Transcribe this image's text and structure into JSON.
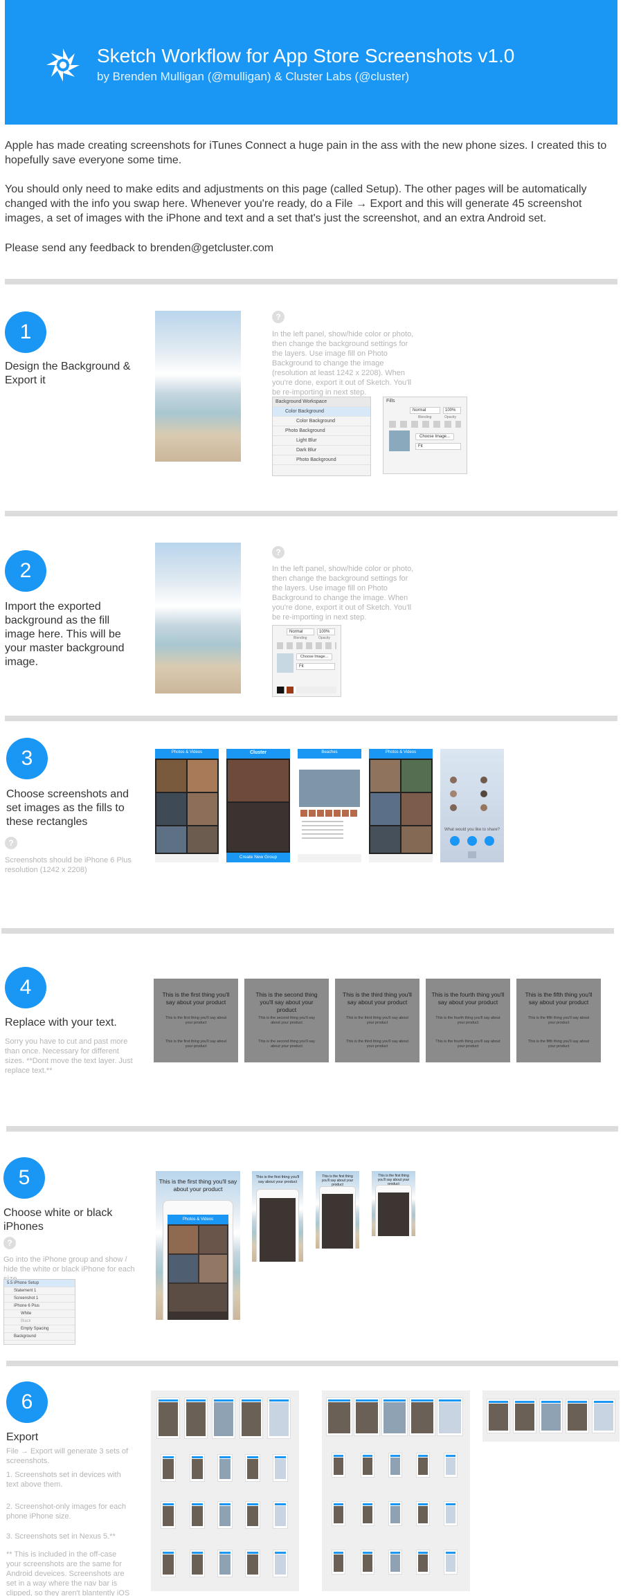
{
  "header": {
    "title": "Sketch Workflow for App Store Screenshots v1.0",
    "subtitle": "by Brenden Mulligan (@mulligan) & Cluster Labs (@cluster)",
    "bg_color": "#1a96f4"
  },
  "intro": {
    "p1": "Apple has made creating screenshots for iTunes Connect a huge pain in the ass with the new phone sizes. I created this to hopefully save everyone some time.",
    "p2": "You should only need to make edits and adjustments on this page (called Setup). The other pages will be automatically changed with the info you swap here. Whenever you're ready, do a File → Export and this will generate 45 screenshot images, a set of images with the iPhone and text and a set that's just the screenshot, and an extra Android set.",
    "p3": "Please send any feedback to brenden@getcluster.com"
  },
  "help_glyph": "?",
  "steps": [
    {
      "number": "1",
      "title": "Design the Background & Export it",
      "help": "In the left panel, show/hide color or photo, then change the background settings for the layers. Use image fill on Photo Background to change the image (resolution at least 1242 x 2208). When you're done, export it out of Sketch. You'll be re-importing in next step.",
      "layers_panel": {
        "rows": [
          "Background Workspace",
          "Color Background",
          "Color Background",
          "Photo Background",
          "Light Blur",
          "Dark Blur",
          "Photo Background"
        ]
      },
      "fills_panel": {
        "title": "Fills",
        "mode": "Normal",
        "opacity": "100%",
        "blending_label": "Blending",
        "opacity_label": "Opacity",
        "choose_label": "Choose Image...",
        "fit": "Fit"
      }
    },
    {
      "number": "2",
      "title": "Import the exported background as the fill image here. This will be your master background image.",
      "help": "In the left panel, show/hide color or photo, then change the background settings for the layers. Use image fill on Photo Background to change the image. When you're done, export it out of Sketch. You'll be re-importing in next step.",
      "fills_panel": {
        "mode": "Normal",
        "opacity": "100%",
        "blending_label": "Blending",
        "opacity_label": "Opacity",
        "choose_label": "Choose Image...",
        "fit": "Fit"
      }
    },
    {
      "number": "3",
      "title": "Choose screenshots and set images as the fills to these rectangles",
      "help": "Screenshots should be iPhone 6 Plus resolution (1242 x 2208)",
      "screens": [
        {
          "header": "Photos & Videos"
        },
        {
          "header": "Cluster",
          "button": "Create New Group"
        },
        {
          "header": "Beaches"
        },
        {
          "header": "Photos & Videos"
        },
        {
          "header": "",
          "prompt": "What would you like to share?"
        }
      ]
    },
    {
      "number": "4",
      "title": "Replace with your text.",
      "help": "Sorry you have to cut and past more than once. Necessary for different sizes. **Dont move the text layer. Just replace text.**",
      "cards": [
        {
          "headline": "This is the first thing you'll say about your product",
          "body": "This is the first thing you'll say about your product",
          "foot": "This is the first thing you'll say about your product"
        },
        {
          "headline": "This is the second thing you'll say about your product",
          "body": "This is the second thing you'll say about your product",
          "foot": "This is the second thing you'll say about your product"
        },
        {
          "headline": "This is the third thing you'll say about your product",
          "body": "This is the third thing you'll say about your product",
          "foot": "This is the third thing you'll say about your product"
        },
        {
          "headline": "This is the fourth thing you'll say about your product",
          "body": "This is the fourth thing you'll say about your product",
          "foot": "This is the fourth thing you'll say about your product"
        },
        {
          "headline": "This is the fifth thing you'll say about your product",
          "body": "This is the fifth thing you'll say about your product",
          "foot": "This is the fifth thing you'll say about your product"
        }
      ]
    },
    {
      "number": "5",
      "title": "Choose white or black iPhones",
      "help": "Go into the iPhone group and show / hide the white or black iPhone for each size.",
      "device_headline": "This is the first thing you'll say about your product",
      "device_header": "Photos & Videos",
      "layers": [
        "5.5 iPhone Setup",
        "Statement 1",
        "Screenshot 1",
        "iPhone 6 Plus",
        "White",
        "Black",
        "Empty Spacing",
        "Background"
      ]
    },
    {
      "number": "6",
      "title": "Export",
      "help_lines": [
        "File → Export will generate 3 sets of screenshots.",
        "1. Screenshots set in devices with text above them.",
        "2. Screenshot-only images for each phone iPhone size.",
        "3. Screenshots set in Nexus 5.**",
        "** This is included in the off-case your screenshots are the same for Android deveices. Screenshots are set in a way where the nav bar is clipped, so they aren't blantently iOS screenshots."
      ]
    }
  ]
}
